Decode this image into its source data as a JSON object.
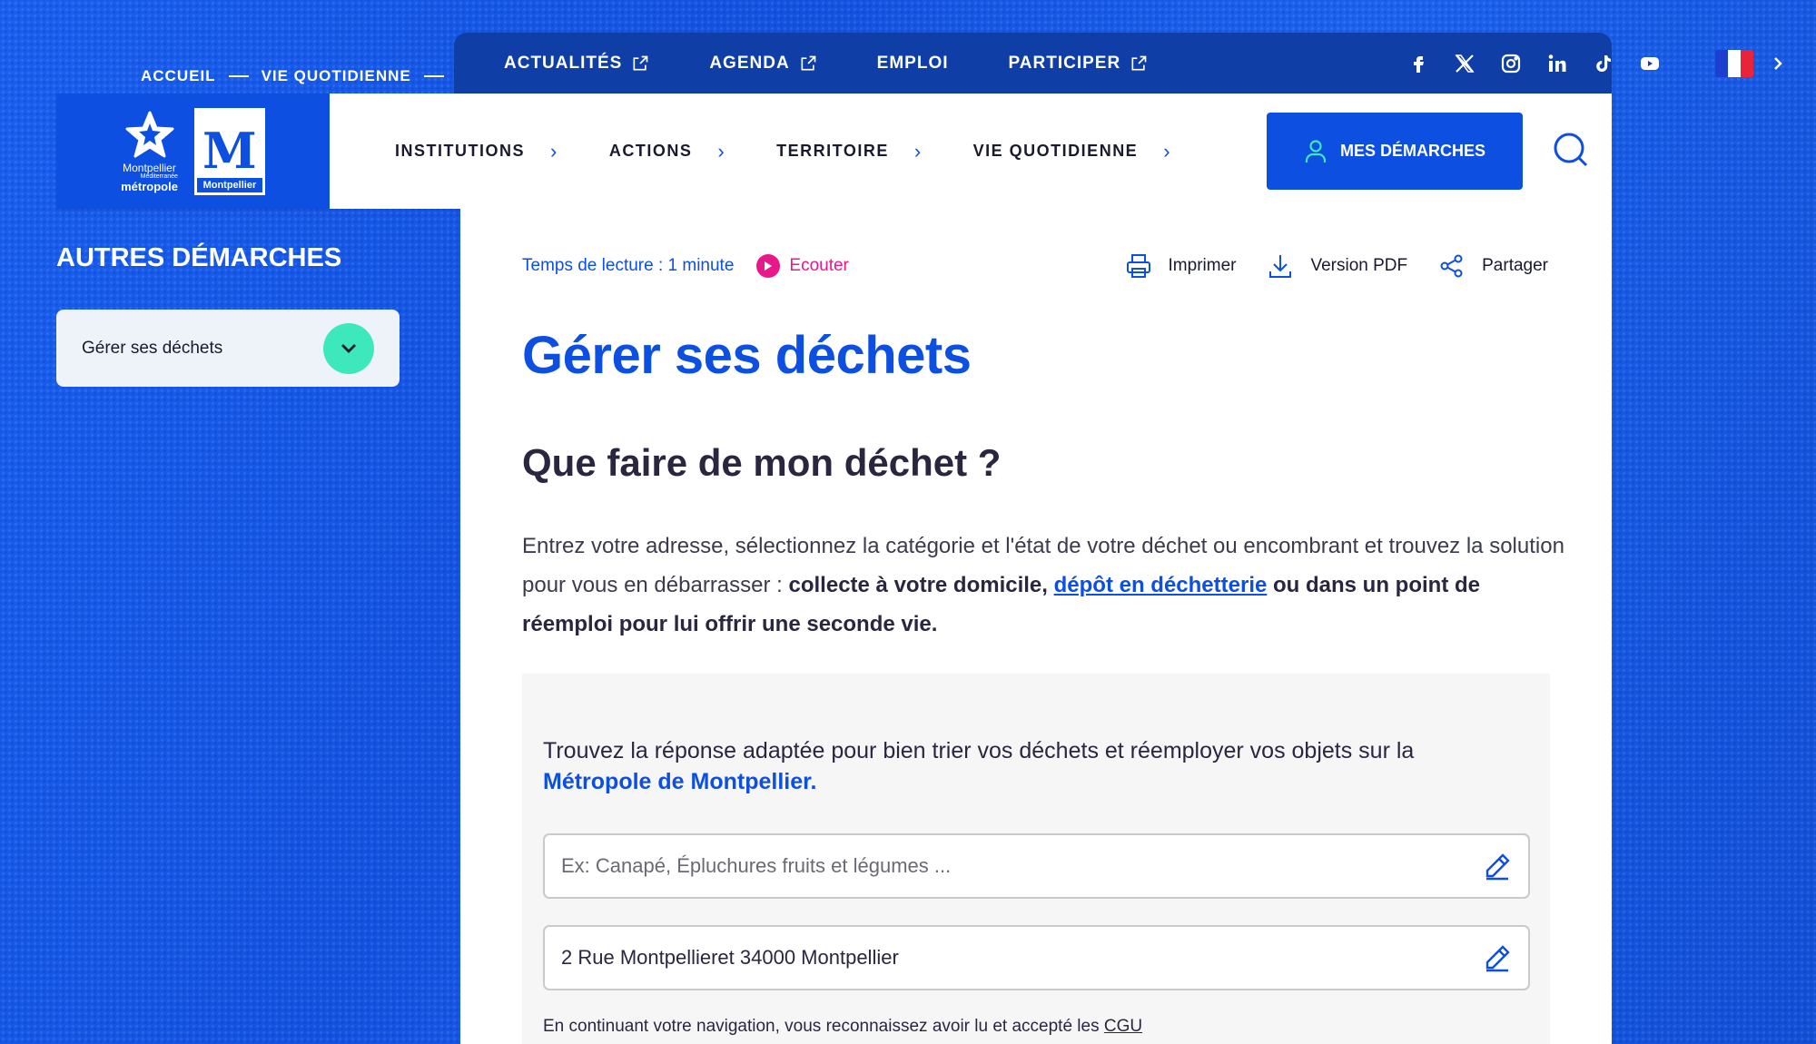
{
  "breadcrumb": {
    "items": [
      "ACCUEIL",
      "VIE QUOTIDIENNE"
    ]
  },
  "topbar": {
    "links": [
      {
        "label": "ACTUALITÉS",
        "external": true
      },
      {
        "label": "AGENDA",
        "external": true
      },
      {
        "label": "EMPLOI",
        "external": false
      },
      {
        "label": "PARTICIPER",
        "external": true
      }
    ],
    "socials": [
      "facebook-icon",
      "x-icon",
      "instagram-icon",
      "linkedin-icon",
      "tiktok-icon",
      "youtube-icon"
    ],
    "language_flag": "fr-flag"
  },
  "logo": {
    "metro_line1": "Montpellier",
    "metro_line2": "Méditerranée",
    "metro_line3": "métropole",
    "city_letter": "M",
    "city_name": "Montpellier"
  },
  "nav": {
    "items": [
      "INSTITUTIONS",
      "ACTIONS",
      "TERRITOIRE",
      "VIE QUOTIDIENNE"
    ],
    "cta_label": "MES DÉMARCHES"
  },
  "sidebar": {
    "title": "AUTRES DÉMARCHES",
    "selected": "Gérer ses déchets"
  },
  "main": {
    "reading_time": "Temps de lecture : 1 minute",
    "listen_label": "Ecouter",
    "tools": {
      "print": "Imprimer",
      "pdf": "Version PDF",
      "share": "Partager"
    },
    "title": "Gérer ses déchets",
    "section_title": "Que faire de mon déchet ?",
    "intro_plain": "Entrez votre adresse, sélectionnez la catégorie et l'état de votre déchet ou encombrant et trouvez la solution pour vous en débarrasser : ",
    "intro_bold1": "collecte à votre domicile,",
    "intro_link": "dépôt en déchetterie",
    "intro_bold2": " ou dans un point de réemploi pour lui offrir une seconde vie."
  },
  "widget": {
    "text": "Trouvez la réponse adaptée pour bien trier vos déchets et réemployer vos objets sur la",
    "text_bold": "Métropole de Montpellier.",
    "search_placeholder": "Ex: Canapé, Épluchures fruits et légumes ...",
    "address_value": "2 Rue Montpellieret 34000 Montpellier",
    "cgu_text": "En continuant votre navigation, vous reconnaissez avoir lu et accepté les ",
    "cgu_link": "CGU"
  },
  "colors": {
    "brand_blue": "#0d4fe0",
    "topbar_blue": "#0f3ea6",
    "accent_pink": "#e8178a",
    "accent_mint": "#3ee8bd"
  }
}
